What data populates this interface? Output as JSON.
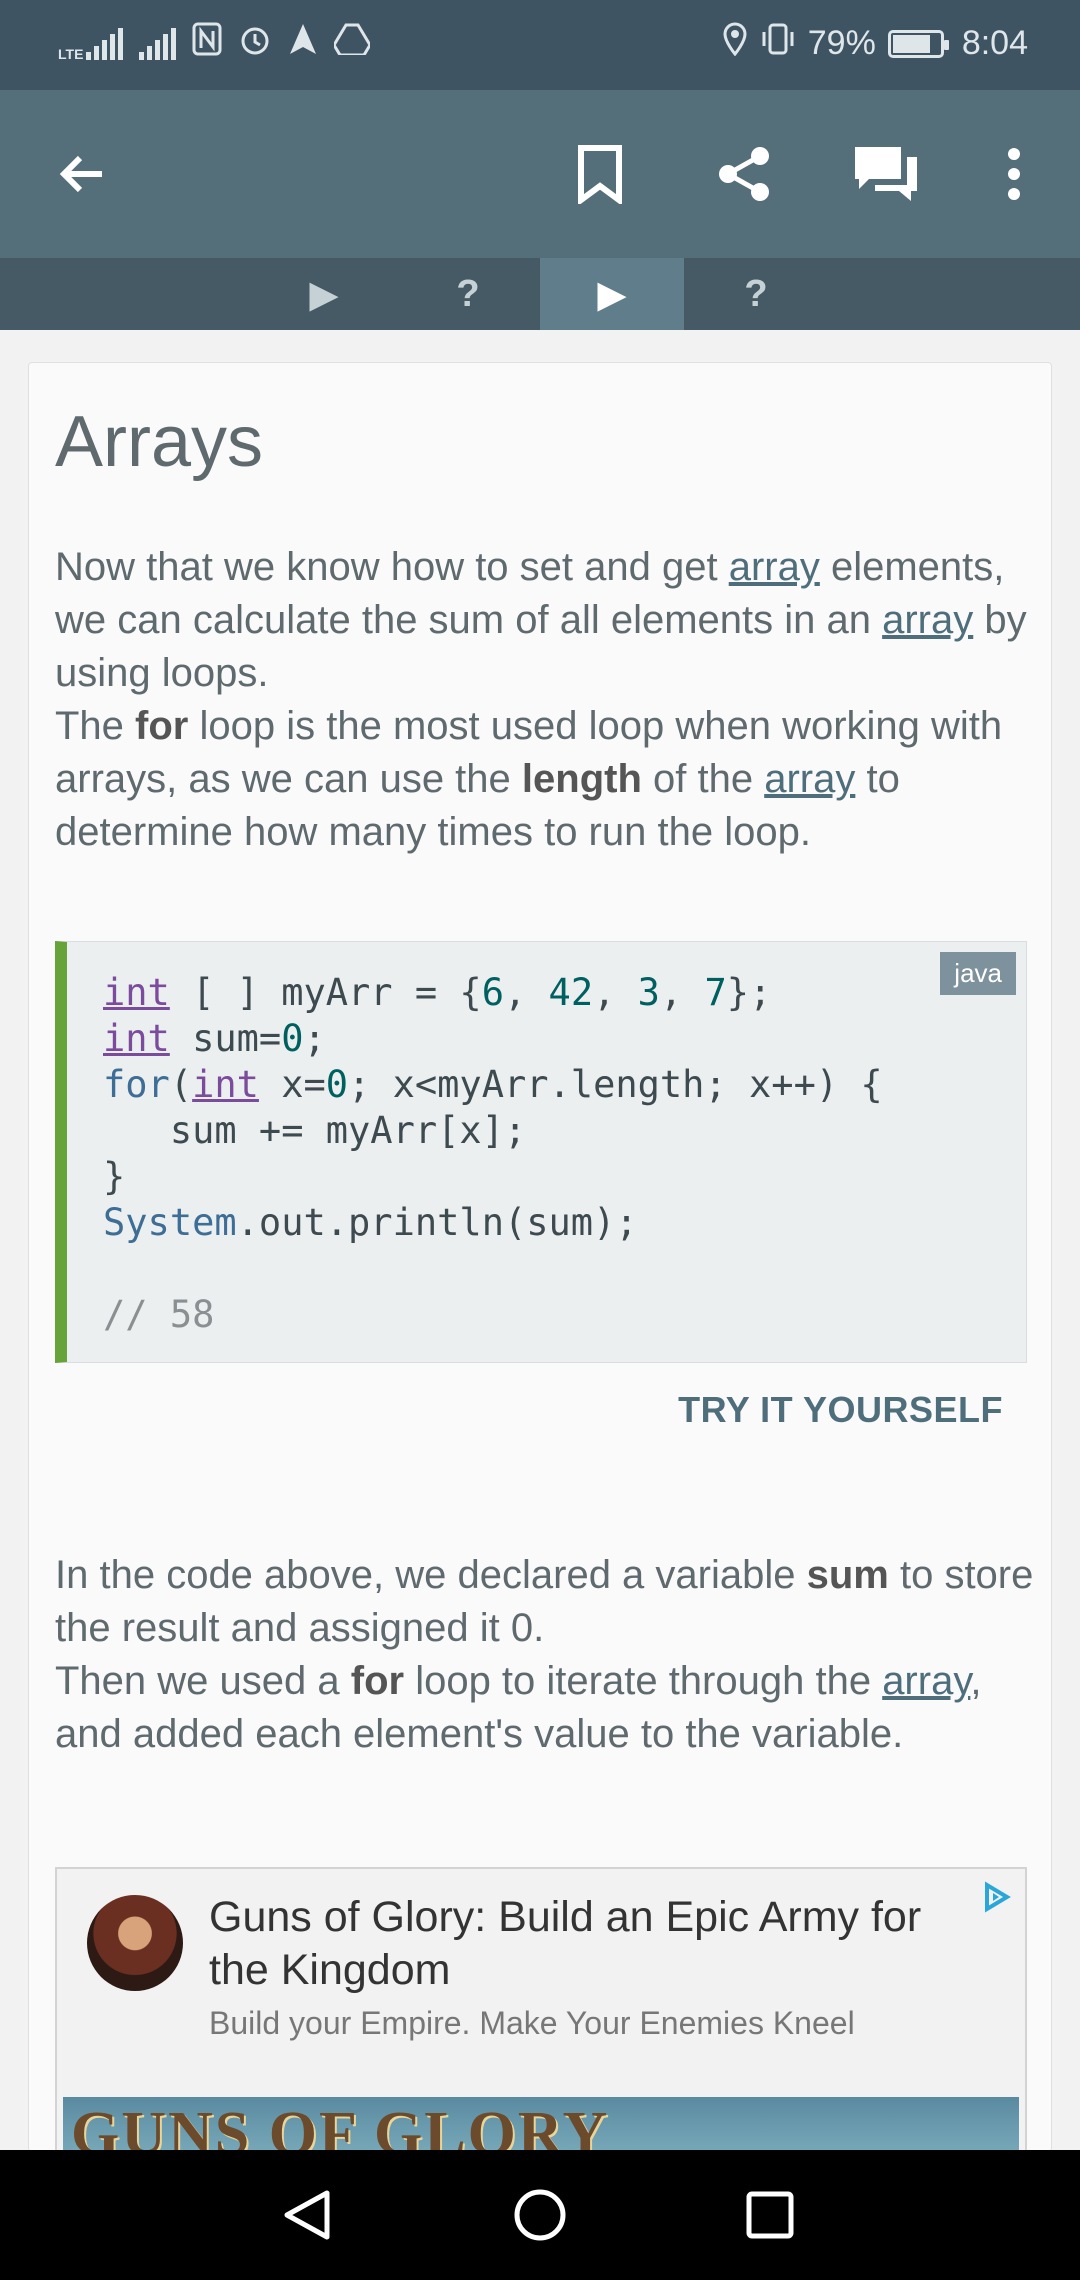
{
  "status_bar": {
    "network": "LTE",
    "battery": "79%",
    "time": "8:04"
  },
  "tabs": [
    {
      "label": "▶",
      "active": false
    },
    {
      "label": "?",
      "active": false
    },
    {
      "label": "▶",
      "active": true
    },
    {
      "label": "?",
      "active": false
    }
  ],
  "lesson": {
    "title": "Arrays",
    "p1_a": "Now that we know how to set and get ",
    "link": "array",
    "p1_b": " elements, we can calculate the sum of all elements in an ",
    "p1_c": " by using loops.",
    "p2_a": "The ",
    "for": "for",
    "p2_b": " loop is the most used loop when working with arrays, as we can use the ",
    "length": "length",
    "p2_c": " of the ",
    "p2_d": " to determine how many times to run the loop.",
    "code_lang": "java",
    "code": {
      "l1_kw": "int",
      "l1_a": " [ ] myArr = {",
      "n1": "6",
      "n2": "42",
      "n3": "3",
      "n4": "7",
      "l1_b": "};",
      "l2_kw": "int",
      "l2_a": " sum=",
      "n0": "0",
      "l2_b": ";",
      "l3_for": "for",
      "l3_kw": "int",
      "l3_a": " x=",
      "l3_b": "; x<myArr.length; x++) {",
      "l4": "   sum += myArr[x];",
      "l5": "}",
      "l6_sys": "System",
      "l6_a": ".out.println(sum);",
      "comment": "// 58"
    },
    "try_label": "TRY IT YOURSELF",
    "p3_a": "In the code above, we declared a variable ",
    "sum": "sum",
    "p3_b": " to store the result and assigned it 0.",
    "p4_a": "Then we used a ",
    "p4_b": " loop to iterate through the ",
    "p4_c": ", and added each element's value to the variable."
  },
  "ad": {
    "title": "Guns of Glory: Build an Epic Army for the Kingdom",
    "subtitle": "Build your Empire. Make Your Enemies Kneel",
    "banner_text": "GUNS OF GLORY"
  }
}
